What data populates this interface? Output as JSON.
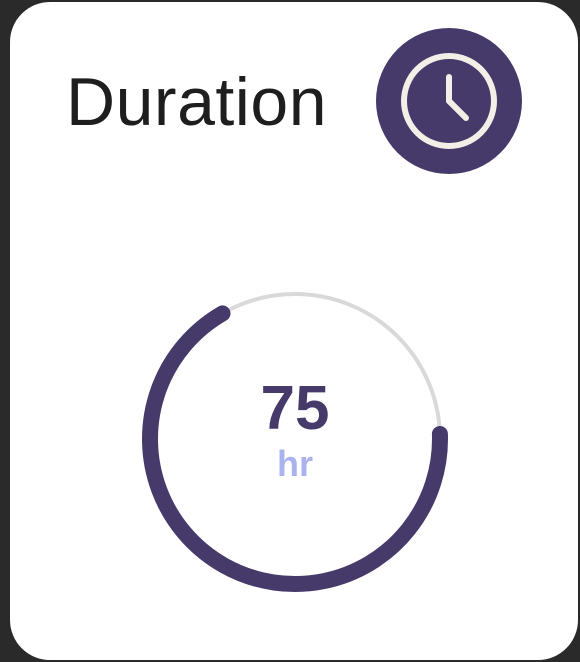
{
  "card": {
    "title": "Duration",
    "icon": "clock-icon"
  },
  "metric": {
    "value": "75",
    "unit": "hr",
    "progress_fraction": 0.75
  },
  "colors": {
    "accent": "#463a6b",
    "track": "#d9d9d9",
    "unit": "#aab3ee",
    "icon_stroke": "#f3eee6"
  }
}
